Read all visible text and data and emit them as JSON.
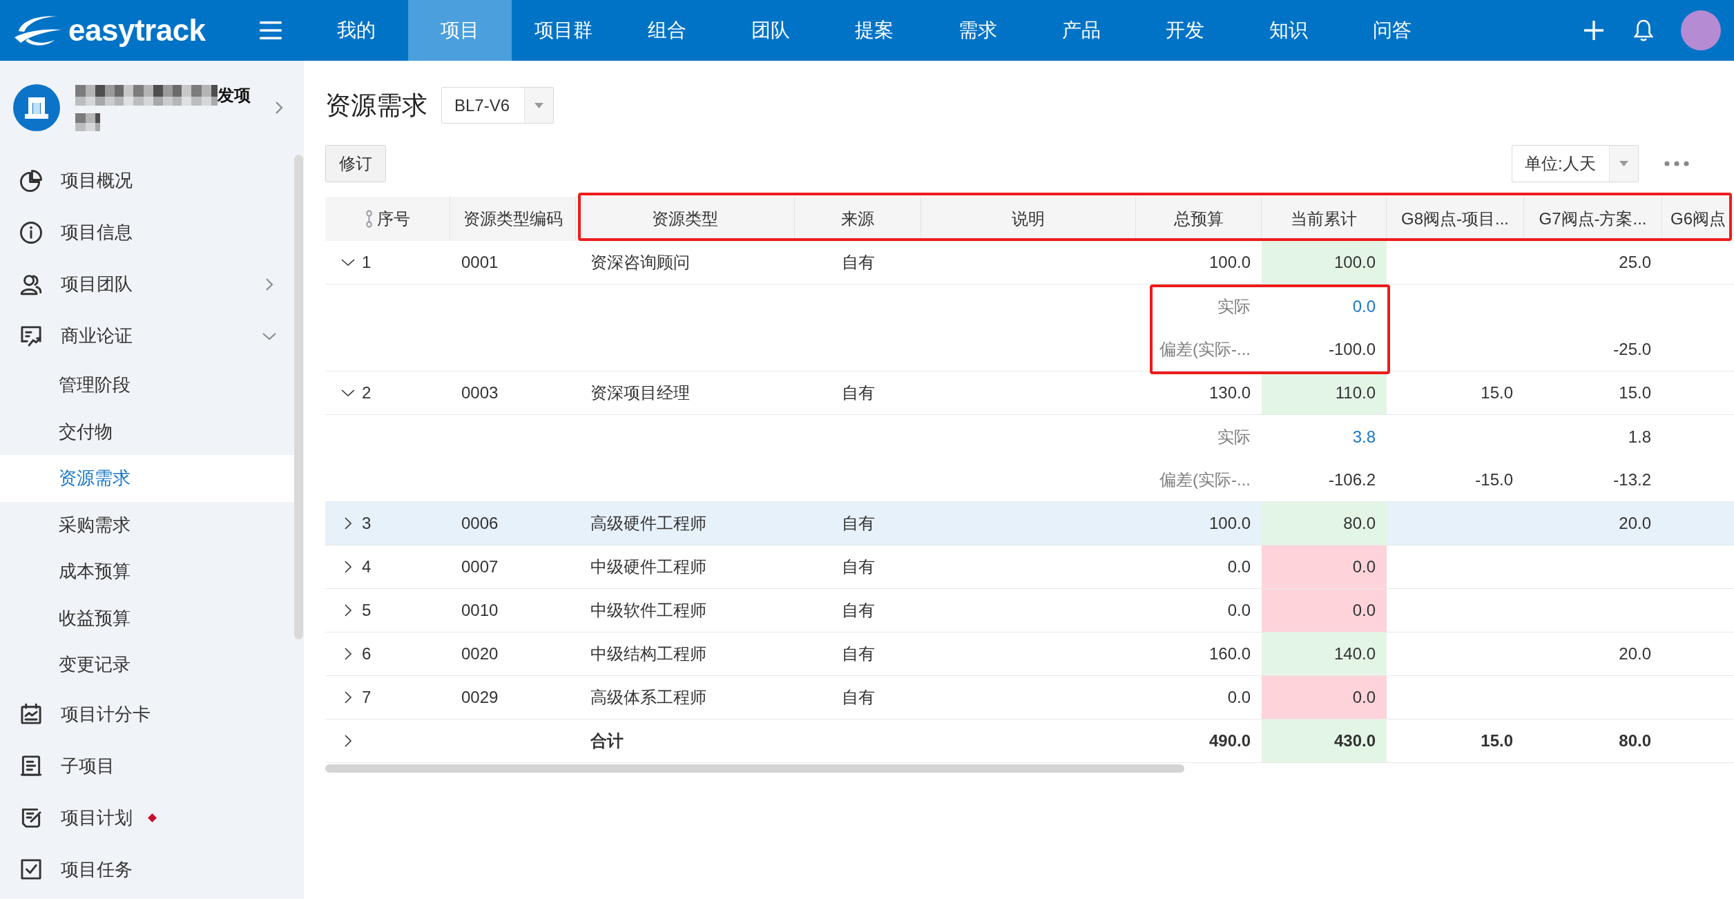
{
  "top_bar": {
    "logo": "easytrack",
    "nav": [
      {
        "label": "我的",
        "selected": false
      },
      {
        "label": "项目",
        "selected": true
      },
      {
        "label": "项目群",
        "selected": false
      },
      {
        "label": "组合",
        "selected": false
      },
      {
        "label": "团队",
        "selected": false
      },
      {
        "label": "提案",
        "selected": false
      },
      {
        "label": "需求",
        "selected": false
      },
      {
        "label": "产品",
        "selected": false
      },
      {
        "label": "开发",
        "selected": false
      },
      {
        "label": "知识",
        "selected": false
      },
      {
        "label": "问答",
        "selected": false
      }
    ]
  },
  "sidebar": {
    "project": {
      "name": "发项"
    },
    "items": [
      {
        "kind": "page",
        "label": "项目概况",
        "selected": false,
        "alert": false
      },
      {
        "kind": "page",
        "label": "项目信息",
        "selected": false,
        "alert": false
      },
      {
        "kind": "group",
        "label": "项目团队",
        "selected": false,
        "alert": false,
        "expanded": false
      },
      {
        "kind": "group",
        "label": "商业论证",
        "selected": false,
        "alert": false,
        "expanded": true,
        "children": [
          {
            "label": "管理阶段",
            "selected": false
          },
          {
            "label": "交付物",
            "selected": false
          },
          {
            "label": "资源需求",
            "selected": true
          },
          {
            "label": "采购需求",
            "selected": false
          },
          {
            "label": "成本预算",
            "selected": false
          },
          {
            "label": "收益预算",
            "selected": false
          },
          {
            "label": "变更记录",
            "selected": false
          }
        ]
      },
      {
        "kind": "page",
        "label": "项目计分卡",
        "selected": false,
        "alert": false
      },
      {
        "kind": "page",
        "label": "子项目",
        "selected": false,
        "alert": false
      },
      {
        "kind": "page",
        "label": "项目计划",
        "selected": false,
        "alert": true
      },
      {
        "kind": "page",
        "label": "项目任务",
        "selected": false,
        "alert": false
      }
    ]
  },
  "content": {
    "title": "资源需求",
    "baseline_select": {
      "value": "BL7-V6"
    },
    "revise_button": "修订",
    "unit_select": {
      "value": "单位:人天"
    }
  },
  "table": {
    "header_annotated": true,
    "columns": [
      {
        "label": "序号"
      },
      {
        "label": "资源类型编码"
      },
      {
        "label": "资源类型"
      },
      {
        "label": "来源"
      },
      {
        "label": "说明"
      },
      {
        "label": "总预算"
      },
      {
        "label": "当前累计"
      },
      {
        "label": "G8阀点-项目..."
      },
      {
        "label": "G7阀点-方案..."
      },
      {
        "label": "G6阀点"
      }
    ],
    "rows": [
      {
        "no": "1",
        "code": "0001",
        "type": "资深咨询顾问",
        "source": "自有",
        "budget": "100.0",
        "cumulative": "100.0",
        "color": "#e3f5e5",
        "g7": "25.0",
        "expanded": true,
        "selected": false,
        "details": {
          "annotated": true,
          "lines": [
            {
              "kind": "actual",
              "label": "实际",
              "cumulative": "0.0"
            },
            {
              "kind": "variance",
              "label": "偏差(实际-...",
              "cumulative": "-100.0",
              "g7": "-25.0"
            }
          ]
        }
      },
      {
        "no": "2",
        "code": "0003",
        "type": "资深项目经理",
        "source": "自有",
        "budget": "130.0",
        "cumulative": "110.0",
        "color": "#e3f5e5",
        "g8": "15.0",
        "g7": "15.0",
        "expanded": true,
        "selected": false,
        "details": {
          "annotated": false,
          "lines": [
            {
              "kind": "actual",
              "label": "实际",
              "cumulative": "3.8",
              "g7": "1.8"
            },
            {
              "kind": "variance",
              "label": "偏差(实际-...",
              "cumulative": "-106.2",
              "g8": "-15.0",
              "g7": "-13.2"
            }
          ]
        }
      },
      {
        "no": "3",
        "code": "0006",
        "type": "高级硬件工程师",
        "source": "自有",
        "budget": "100.0",
        "cumulative": "80.0",
        "color": "#e3f5e5",
        "g7": "20.0",
        "expanded": false,
        "selected": true
      },
      {
        "no": "4",
        "code": "0007",
        "type": "中级硬件工程师",
        "source": "自有",
        "budget": "0.0",
        "cumulative": "0.0",
        "color": "#ffd3da",
        "expanded": false,
        "selected": false
      },
      {
        "no": "5",
        "code": "0010",
        "type": "中级软件工程师",
        "source": "自有",
        "budget": "0.0",
        "cumulative": "0.0",
        "color": "#ffd3da",
        "expanded": false,
        "selected": false
      },
      {
        "no": "6",
        "code": "0020",
        "type": "中级结构工程师",
        "source": "自有",
        "budget": "160.0",
        "cumulative": "140.0",
        "color": "#e3f5e5",
        "g7": "20.0",
        "expanded": false,
        "selected": false
      },
      {
        "no": "7",
        "code": "0029",
        "type": "高级体系工程师",
        "source": "自有",
        "budget": "0.0",
        "cumulative": "0.0",
        "color": "#ffd3da",
        "expanded": false,
        "selected": false
      }
    ],
    "total": {
      "label": "合计",
      "budget": "490.0",
      "cumulative": "430.0",
      "color": "#e3f5e5",
      "g8": "15.0",
      "g7": "80.0",
      "expanded": false
    }
  }
}
